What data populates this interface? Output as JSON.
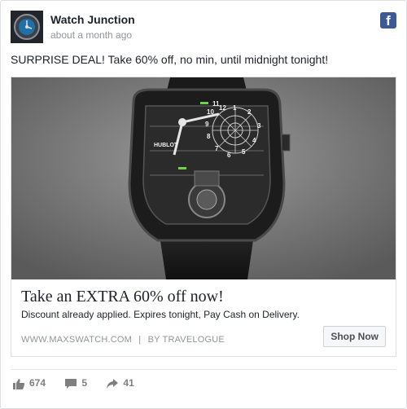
{
  "post": {
    "page_name": "Watch Junction",
    "time": "about a month ago",
    "text": "SURPRISE DEAL! Take 60% off, no min, until midnight tonight!",
    "platform_icon": "facebook-icon"
  },
  "watch_image": {
    "brand": "HUBLOT",
    "hour_marks": [
      "12",
      "1",
      "2",
      "3",
      "4",
      "5",
      "6",
      "7",
      "8",
      "9",
      "10",
      "11"
    ]
  },
  "ad": {
    "headline": "Take an EXTRA 60% off now!",
    "description": "Discount already applied. Expires tonight, Pay Cash on Delivery.",
    "domain": "WWW.MAXSWATCH.COM",
    "separator": "|",
    "source": "BY TRAVELOGUE",
    "cta_label": "Shop Now"
  },
  "stats": {
    "likes": "674",
    "comments": "5",
    "shares": "41"
  },
  "colors": {
    "facebook_blue": "#3b5998",
    "text_dark": "#1d2129",
    "text_muted": "#90949c"
  }
}
